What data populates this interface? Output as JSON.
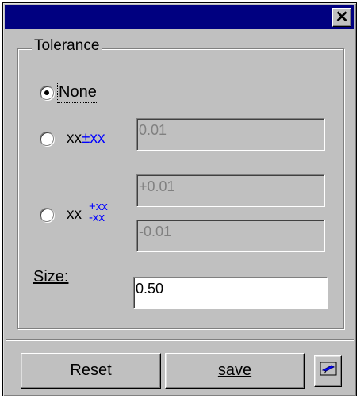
{
  "window": {
    "close_symbol": "✕"
  },
  "group": {
    "label": "Tolerance"
  },
  "options": {
    "none_label": "None",
    "sym_xx": "xx",
    "sym_pm": "±",
    "sym_plus": "+",
    "sym_minus": "-"
  },
  "fields": {
    "symmetric": "0.01",
    "upper": "+0.01",
    "lower": "-0.01",
    "size": "0.50"
  },
  "size_label": "Size:",
  "buttons": {
    "reset": "Reset",
    "save": "save"
  },
  "selected_option": "none",
  "icons": {
    "close": "close-icon",
    "extra": "tool-icon"
  }
}
